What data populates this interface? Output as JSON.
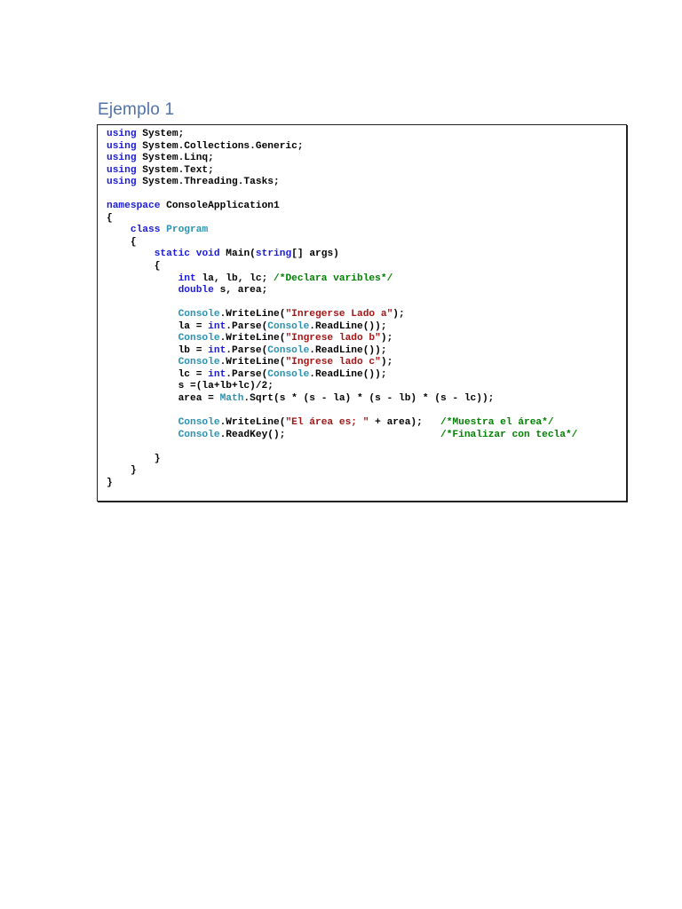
{
  "title": "Ejemplo 1",
  "colors": {
    "keyword": "#1a1ad8",
    "type": "#2b91af",
    "string": "#a31515",
    "comment": "#008000",
    "title": "#4f73a8"
  },
  "code_lines": [
    [
      [
        "using",
        "kw"
      ],
      [
        " System;",
        "tx"
      ]
    ],
    [
      [
        "using",
        "kw"
      ],
      [
        " System.Collections.Generic;",
        "tx"
      ]
    ],
    [
      [
        "using",
        "kw"
      ],
      [
        " System.Linq;",
        "tx"
      ]
    ],
    [
      [
        "using",
        "kw"
      ],
      [
        " System.Text;",
        "tx"
      ]
    ],
    [
      [
        "using",
        "kw"
      ],
      [
        " System.Threading.Tasks;",
        "tx"
      ]
    ],
    [],
    [
      [
        "namespace",
        "kw"
      ],
      [
        " ConsoleApplication1",
        "tx"
      ]
    ],
    [
      [
        "{",
        "tx"
      ]
    ],
    [
      [
        "    ",
        "tx"
      ],
      [
        "class",
        "kw"
      ],
      [
        " ",
        "tx"
      ],
      [
        "Program",
        "ty"
      ]
    ],
    [
      [
        "    {",
        "tx"
      ]
    ],
    [
      [
        "        ",
        "tx"
      ],
      [
        "static",
        "kw"
      ],
      [
        " ",
        "tx"
      ],
      [
        "void",
        "kw"
      ],
      [
        " Main(",
        "tx"
      ],
      [
        "string",
        "kw"
      ],
      [
        "[] args)",
        "tx"
      ]
    ],
    [
      [
        "        {",
        "tx"
      ]
    ],
    [
      [
        "            ",
        "tx"
      ],
      [
        "int",
        "kw"
      ],
      [
        " la, lb, lc; ",
        "tx"
      ],
      [
        "/*Declara varibles*/",
        "cm"
      ]
    ],
    [
      [
        "            ",
        "tx"
      ],
      [
        "double",
        "kw"
      ],
      [
        " s, area;",
        "tx"
      ]
    ],
    [],
    [
      [
        "            ",
        "tx"
      ],
      [
        "Console",
        "ty"
      ],
      [
        ".WriteLine(",
        "tx"
      ],
      [
        "\"Inregerse Lado a\"",
        "st"
      ],
      [
        ");",
        "tx"
      ]
    ],
    [
      [
        "            la = ",
        "tx"
      ],
      [
        "int",
        "kw"
      ],
      [
        ".Parse(",
        "tx"
      ],
      [
        "Console",
        "ty"
      ],
      [
        ".ReadLine());",
        "tx"
      ]
    ],
    [
      [
        "            ",
        "tx"
      ],
      [
        "Console",
        "ty"
      ],
      [
        ".WriteLine(",
        "tx"
      ],
      [
        "\"Ingrese lado b\"",
        "st"
      ],
      [
        ");",
        "tx"
      ]
    ],
    [
      [
        "            lb = ",
        "tx"
      ],
      [
        "int",
        "kw"
      ],
      [
        ".Parse(",
        "tx"
      ],
      [
        "Console",
        "ty"
      ],
      [
        ".ReadLine());",
        "tx"
      ]
    ],
    [
      [
        "            ",
        "tx"
      ],
      [
        "Console",
        "ty"
      ],
      [
        ".WriteLine(",
        "tx"
      ],
      [
        "\"Ingrese lado c\"",
        "st"
      ],
      [
        ");",
        "tx"
      ]
    ],
    [
      [
        "            lc = ",
        "tx"
      ],
      [
        "int",
        "kw"
      ],
      [
        ".Parse(",
        "tx"
      ],
      [
        "Console",
        "ty"
      ],
      [
        ".ReadLine());",
        "tx"
      ]
    ],
    [
      [
        "            s =(la+lb+lc)/2;",
        "tx"
      ]
    ],
    [
      [
        "            area = ",
        "tx"
      ],
      [
        "Math",
        "ty"
      ],
      [
        ".Sqrt(s * (s - la) * (s - lb) * (s - lc));",
        "tx"
      ]
    ],
    [],
    [
      [
        "            ",
        "tx"
      ],
      [
        "Console",
        "ty"
      ],
      [
        ".WriteLine(",
        "tx"
      ],
      [
        "\"El área es; \"",
        "st"
      ],
      [
        " + area);   ",
        "tx"
      ],
      [
        "/*Muestra el área*/",
        "cm"
      ]
    ],
    [
      [
        "            ",
        "tx"
      ],
      [
        "Console",
        "ty"
      ],
      [
        ".ReadKey();                          ",
        "tx"
      ],
      [
        "/*Finalizar con tecla*/",
        "cm"
      ]
    ],
    [],
    [
      [
        "        }",
        "tx"
      ]
    ],
    [
      [
        "    }",
        "tx"
      ]
    ],
    [
      [
        "}",
        "tx"
      ]
    ]
  ]
}
